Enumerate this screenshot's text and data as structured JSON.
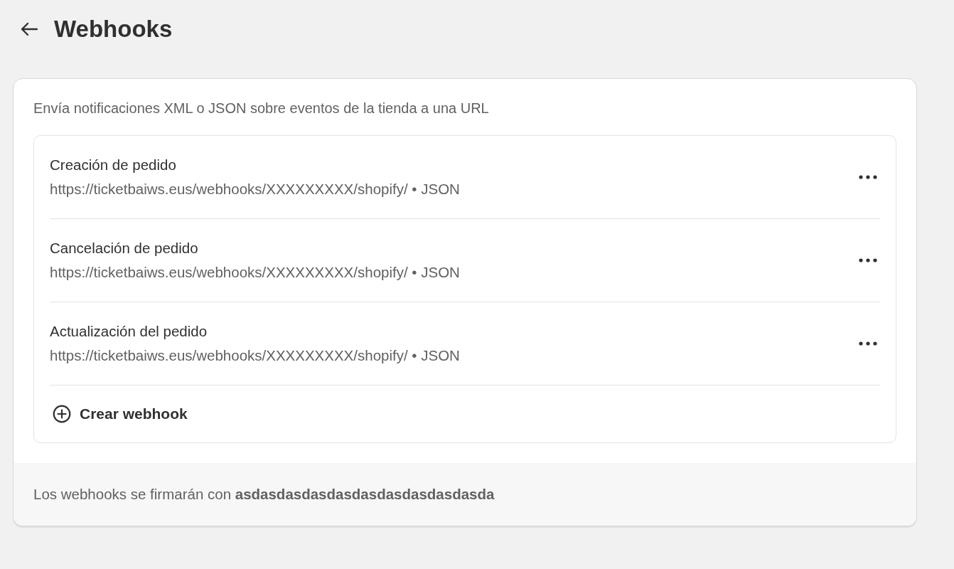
{
  "header": {
    "title": "Webhooks"
  },
  "card": {
    "description": "Envía notificaciones XML o JSON sobre eventos de la tienda a una URL",
    "webhooks": [
      {
        "name": "Creación de pedido",
        "detail": "https://ticketbaiws.eus/webhooks/XXXXXXXXX/shopify/ • JSON"
      },
      {
        "name": "Cancelación de pedido",
        "detail": "https://ticketbaiws.eus/webhooks/XXXXXXXXX/shopify/ • JSON"
      },
      {
        "name": "Actualización del pedido",
        "detail": "https://ticketbaiws.eus/webhooks/XXXXXXXXX/shopify/ • JSON"
      }
    ],
    "create_button": "Crear webhook",
    "footer": "Los webhooks se firmarán con **asdasdasdasdasdasdasdasdasdasda**"
  }
}
